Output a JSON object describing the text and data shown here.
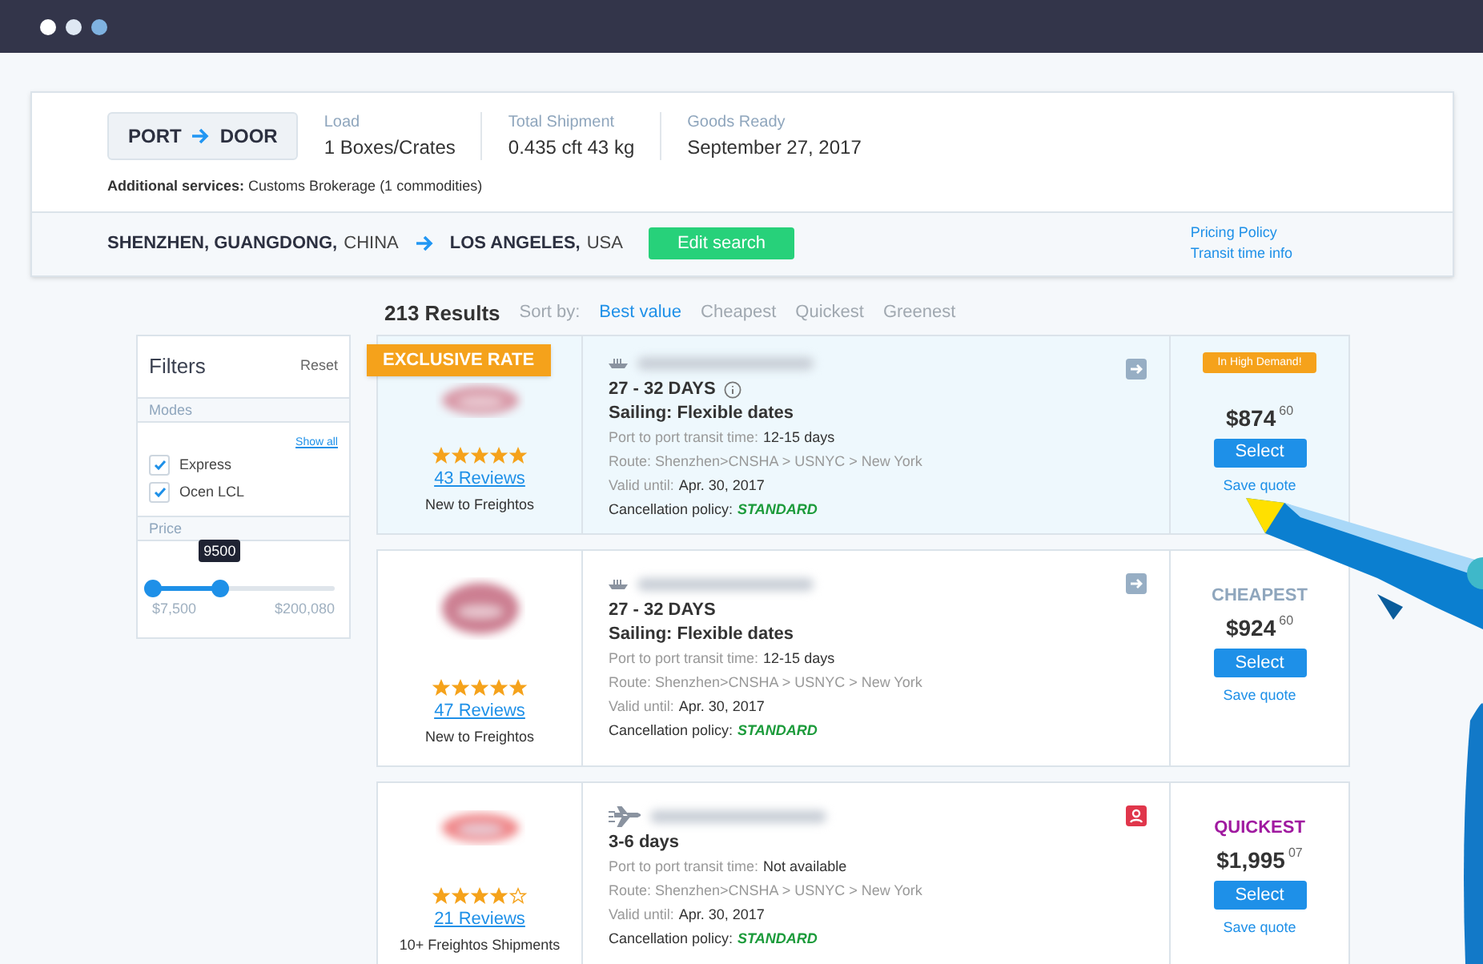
{
  "search": {
    "origin_type": "PORT",
    "destination_type": "DOOR",
    "fields": [
      {
        "label": "Load",
        "value": "1 Boxes/Crates"
      },
      {
        "label": "Total Shipment",
        "value": "0.435 cft 43 kg"
      },
      {
        "label": "Goods Ready",
        "value": "September 27, 2017"
      }
    ],
    "additional_services": "**Additional services:** Customs Brokerage (1 commodities)",
    "origin_city": "SHENZHEN, GUANGDONG,",
    "origin_country": "CHINA",
    "destination_city": "LOS ANGELES,",
    "destination_country": "USA",
    "edit_button": "Edit search",
    "links": [
      "Pricing Policy",
      "Transit time info"
    ]
  },
  "results": {
    "count": "213 Results",
    "sort_label": "Sort by:",
    "sort_options": [
      {
        "label": "Best value",
        "selected": true
      },
      {
        "label": "Cheapest",
        "selected": false
      },
      {
        "label": "Quickest",
        "selected": false
      },
      {
        "label": "Greenest",
        "selected": false
      }
    ]
  },
  "filters": {
    "title": "Filters",
    "reset": "Reset",
    "modes_title": "Modes",
    "show_all": "Show all",
    "modes": [
      {
        "label": "Express",
        "checked": true
      },
      {
        "label": "Ocen LCL",
        "checked": true
      }
    ],
    "price_title": "Price",
    "price_slider": {
      "tooltip": "9500",
      "level": 0.37,
      "min": "$7,500",
      "max": "$200,080"
    }
  },
  "quotes": [
    {
      "highlighted": true,
      "ribbon": "EXCLUSIVE RATE",
      "stars": 5,
      "reviews": "43 Reviews",
      "vendor_note": "New to Freightos",
      "mode": {
        "kind": "ship"
      },
      "duration": "27 - 32 DAYS",
      "info": true,
      "sailing": "Sailing: Flexible dates",
      "transit_label": "Port to port transit time:",
      "transit_value": "12-15 days",
      "route": "Route: Shenzhen>CNSHA > USNYC > New York",
      "valid_label": "Valid until:",
      "valid_value": "Apr. 30, 2017",
      "cancel_label": "Cancellation policy:",
      "cancel_value": "STANDARD",
      "badge": {
        "kind": "arrow"
      },
      "tag": {
        "kind": "demand",
        "text": "In High Demand!"
      },
      "price": "$874",
      "cents": "60",
      "select": "Select",
      "save": "Save quote"
    },
    {
      "highlighted": false,
      "stars": 5,
      "reviews": "47 Reviews",
      "vendor_note": "New to Freightos",
      "mode": {
        "kind": "ship"
      },
      "duration": "27 - 32 DAYS",
      "info": false,
      "sailing": "Sailing: Flexible dates",
      "transit_label": "Port to port transit time:",
      "transit_value": "12-15 days",
      "route": "Route: Shenzhen>CNSHA > USNYC > New York",
      "valid_label": "Valid until:",
      "valid_value": "Apr. 30, 2017",
      "cancel_label": "Cancellation policy:",
      "cancel_value": "STANDARD",
      "badge": {
        "kind": "arrow"
      },
      "tag": {
        "kind": "cheapest",
        "text": "CHEAPEST"
      },
      "price": "$924",
      "cents": "60",
      "select": "Select",
      "save": "Save quote"
    },
    {
      "highlighted": false,
      "stars": 4,
      "reviews": "21 Reviews",
      "vendor_note": "10+ Freightos Shipments",
      "mode": {
        "kind": "plane"
      },
      "duration": "3-6 days",
      "info": false,
      "transit_label": "Port to port transit time:",
      "transit_value": "Not available",
      "route": "Route: Shenzhen>CNSHA > USNYC > New York",
      "valid_label": "Valid until:",
      "valid_value": "Apr. 30, 2017",
      "cancel_label": "Cancellation policy:",
      "cancel_value": "STANDARD",
      "badge": {
        "kind": "person"
      },
      "tag": {
        "kind": "quickest",
        "text": "QUICKEST"
      },
      "price": "$1,995",
      "cents": "07",
      "select": "Select",
      "save": "Save quote"
    }
  ]
}
